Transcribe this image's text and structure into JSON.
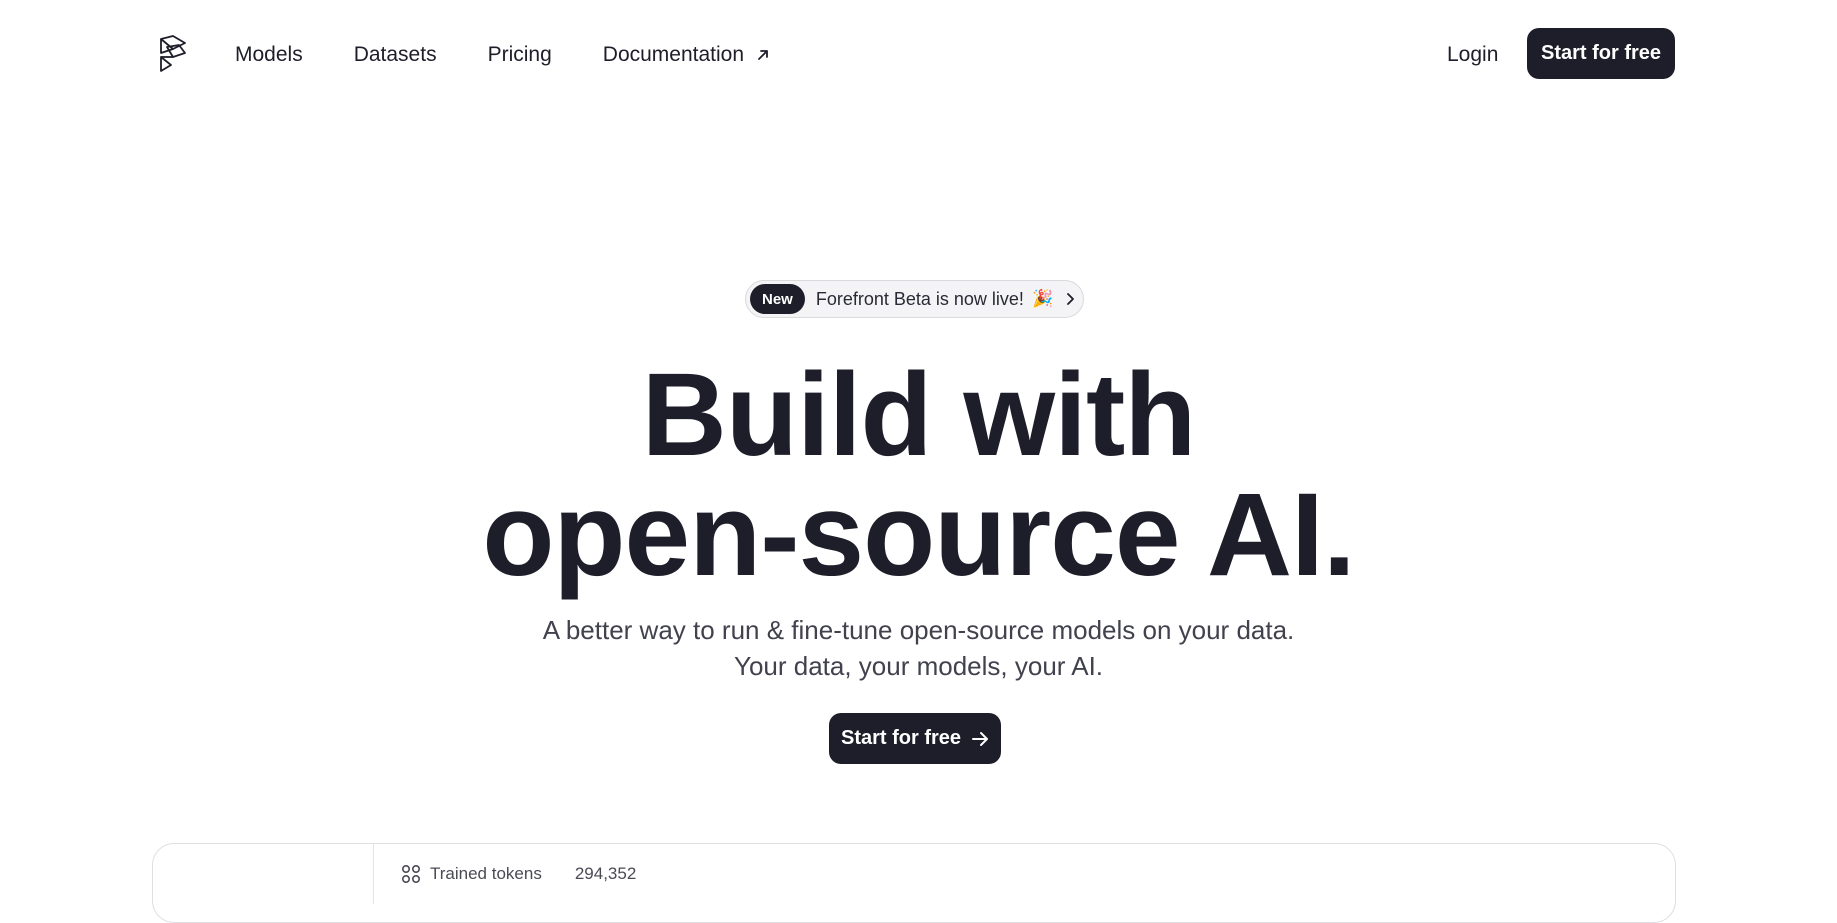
{
  "header": {
    "logo_icon": "forefront-logo-icon",
    "nav": [
      {
        "label": "Models"
      },
      {
        "label": "Datasets"
      },
      {
        "label": "Pricing"
      },
      {
        "label": "Documentation",
        "icon": "external-arrow-icon"
      }
    ],
    "login_label": "Login",
    "cta_label": "Start for free"
  },
  "hero": {
    "badge_tag": "New",
    "badge_text": "Forefront Beta is now live!",
    "badge_emoji": "🎉",
    "title_line1": "Build with",
    "title_line2": "open-source AI.",
    "subtitle_line1": "A better way to run & fine-tune open-source models on your data.",
    "subtitle_line2": "Your data, your models, your AI.",
    "cta_label": "Start for free"
  },
  "panel": {
    "stat_icon": "grid-icon",
    "stat_label": "Trained tokens",
    "stat_value": "294,352"
  },
  "colors": {
    "primary_dark": "#1e1e2a",
    "text_muted": "#42424e",
    "border": "#dedee3"
  }
}
